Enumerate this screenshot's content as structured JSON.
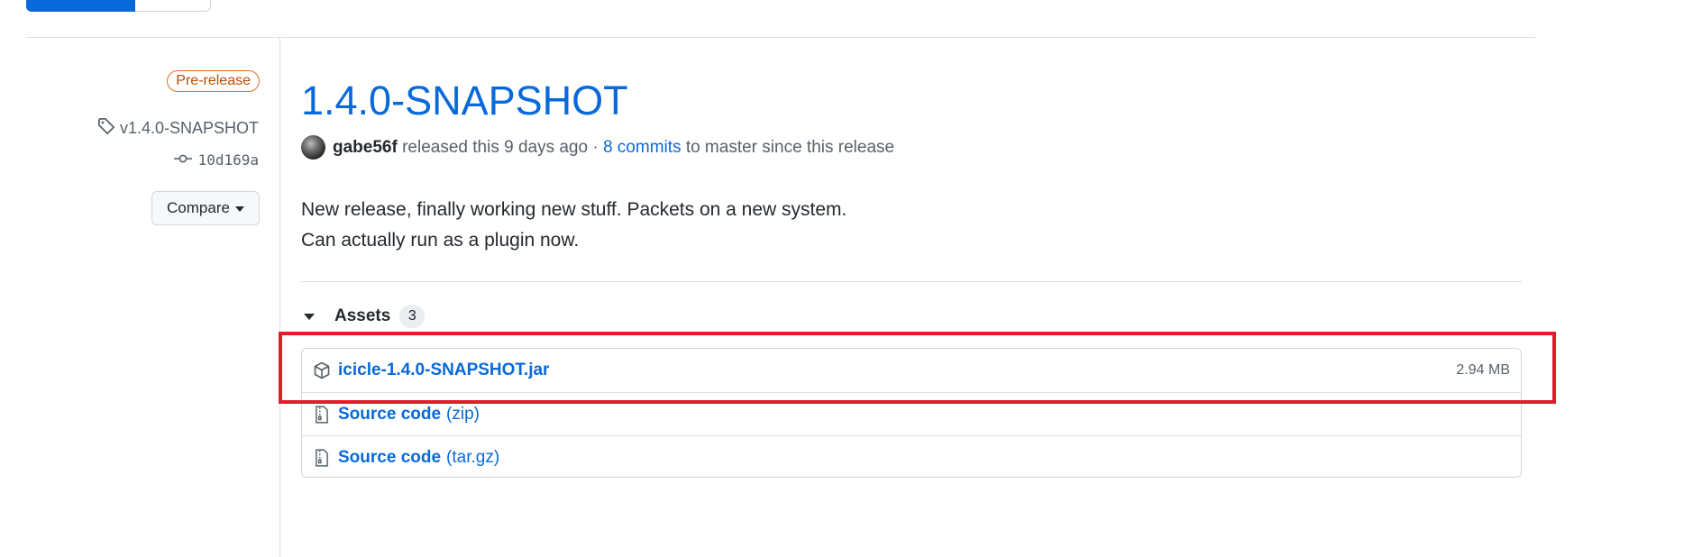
{
  "release": {
    "prerelease_label": "Pre-release",
    "tag": "v1.4.0-SNAPSHOT",
    "commit": "10d169a",
    "compare_label": "Compare",
    "title": "1.4.0-SNAPSHOT",
    "author": "gabe56f",
    "released_text": "released this 9 days ago ·",
    "commits_link": "8 commits",
    "since_text": "to master since this release",
    "body_lines": [
      "New release, finally working new stuff. Packets on a new system.",
      "Can actually run as a plugin now."
    ]
  },
  "assets": {
    "label": "Assets",
    "count": "3",
    "items": [
      {
        "name": "icicle-1.4.0-SNAPSHOT.jar",
        "ext": "",
        "size": "2.94 MB",
        "icon": "package-icon"
      },
      {
        "name": "Source code",
        "ext": "(zip)",
        "size": "",
        "icon": "file-zip-icon"
      },
      {
        "name": "Source code",
        "ext": "(tar.gz)",
        "size": "",
        "icon": "file-zip-icon"
      }
    ]
  },
  "colors": {
    "link": "#0969da",
    "prerelease": "#bc4c00",
    "highlight": "#e01e2a"
  }
}
